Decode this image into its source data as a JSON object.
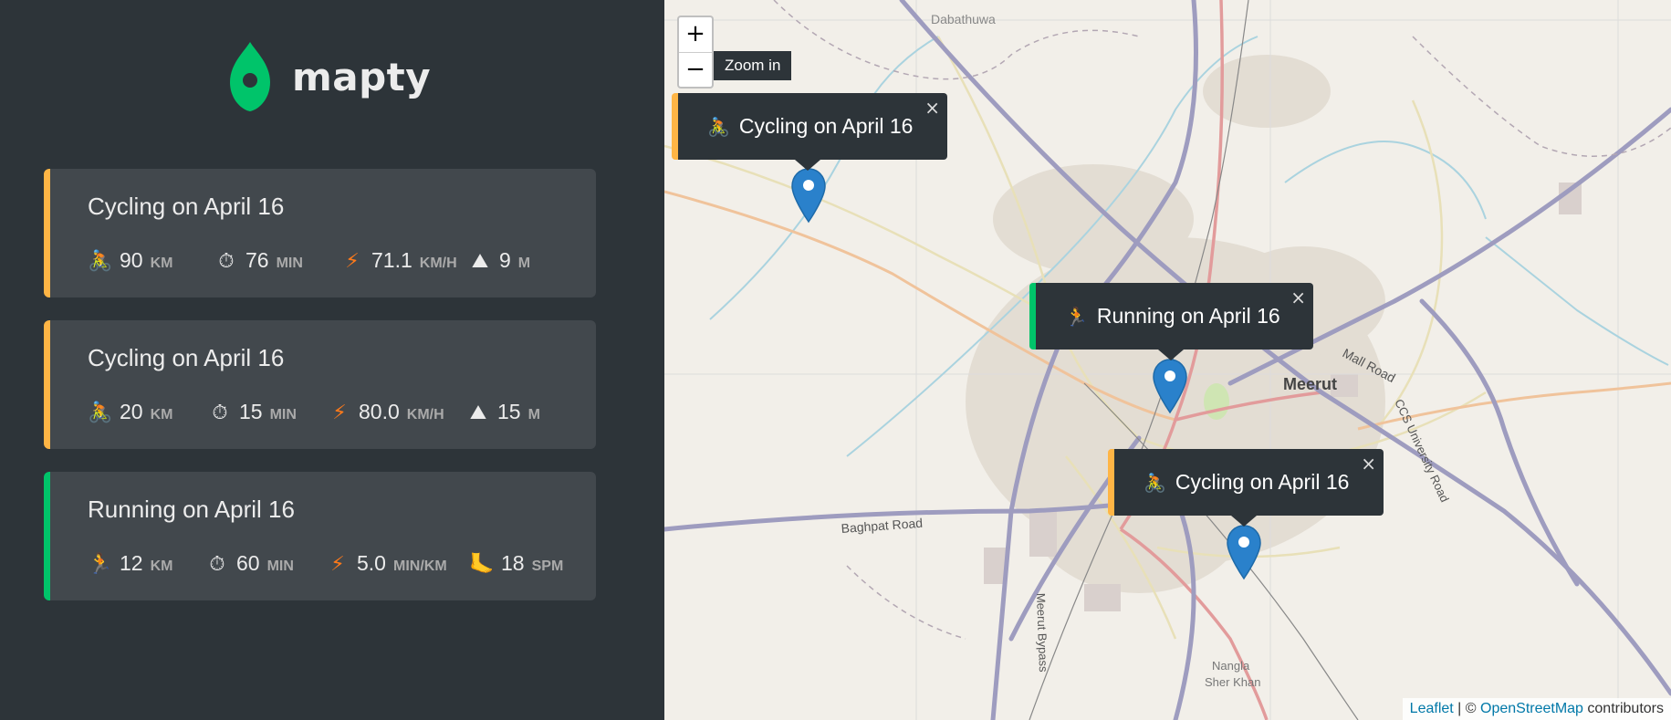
{
  "app": {
    "name": "mapty"
  },
  "workouts": [
    {
      "type": "cycling",
      "title": "Cycling on April 16",
      "stats": [
        {
          "icon": "🚴",
          "value": "90",
          "unit": "KM"
        },
        {
          "icon": "⏱",
          "value": "76",
          "unit": "MIN"
        },
        {
          "icon": "⚡",
          "value": "71.1",
          "unit": "KM/H"
        },
        {
          "icon": "⛰",
          "value": "9",
          "unit": "M"
        }
      ]
    },
    {
      "type": "cycling",
      "title": "Cycling on April 16",
      "stats": [
        {
          "icon": "🚴",
          "value": "20",
          "unit": "KM"
        },
        {
          "icon": "⏱",
          "value": "15",
          "unit": "MIN"
        },
        {
          "icon": "⚡",
          "value": "80.0",
          "unit": "KM/H"
        },
        {
          "icon": "⛰",
          "value": "15",
          "unit": "M"
        }
      ]
    },
    {
      "type": "running",
      "title": "Running on April 16",
      "stats": [
        {
          "icon": "🏃",
          "value": "12",
          "unit": "KM"
        },
        {
          "icon": "⏱",
          "value": "60",
          "unit": "MIN"
        },
        {
          "icon": "⚡",
          "value": "5.0",
          "unit": "MIN/KM"
        },
        {
          "icon": "🦶",
          "value": "18",
          "unit": "SPM"
        }
      ]
    }
  ],
  "map": {
    "zoom_in_label": "+",
    "zoom_out_label": "−",
    "zoom_tooltip": "Zoom in",
    "popups": [
      {
        "type": "cycling",
        "icon": "🚴",
        "text": "Cycling on April 16",
        "close": "×"
      },
      {
        "type": "running",
        "icon": "🏃",
        "text": "Running on April 16",
        "close": "×"
      },
      {
        "type": "cycling",
        "icon": "🚴",
        "text": "Cycling on April 16",
        "close": "×"
      }
    ],
    "places": {
      "dabathuwa": "Dabathuwa",
      "meerut": "Meerut",
      "mall_road": "Mall Road",
      "ccs_road": "CCS University Road",
      "baghpat_road": "Baghpat Road",
      "bypass": "Meerut Bypass",
      "nangla": "Nangla",
      "sher_khan": "Sher Khan"
    },
    "attribution": {
      "leaflet": "Leaflet",
      "separator": " | © ",
      "osm": "OpenStreetMap",
      "suffix": " contributors"
    }
  },
  "colors": {
    "cycling": "#ffb545",
    "running": "#00c46a",
    "sidebar": "#2d3439",
    "card": "#42484d"
  }
}
